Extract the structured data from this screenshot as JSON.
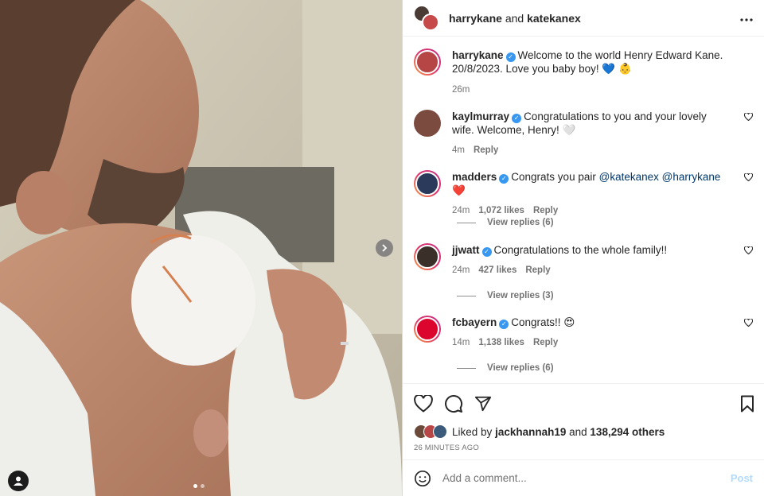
{
  "media": {
    "slides": 2,
    "active_slide": 1,
    "next_icon": "chevron-right-icon",
    "tag_icon": "user-tag-icon"
  },
  "header": {
    "user1": "harrykane",
    "joiner": "and",
    "user2": "katekanex",
    "more_icon": "more-horizontal-icon"
  },
  "caption": {
    "username": "harrykane",
    "text": "Welcome to the world Henry Edward Kane. 20/8/2023. Love you baby boy! 💙 👶",
    "time": "26m"
  },
  "comments": [
    {
      "username": "kaylmurray",
      "text": "Congratulations to you and your lovely wife. Welcome, Henry! 🤍",
      "time": "4m",
      "likes": "",
      "reply": "Reply",
      "view_replies": ""
    },
    {
      "username": "madders",
      "text": "Congrats you pair",
      "mentions": [
        "@katekanex",
        "@harrykane"
      ],
      "emoji": "❤️",
      "time": "24m",
      "likes": "1,072 likes",
      "reply": "Reply",
      "view_replies": "View replies (6)"
    },
    {
      "username": "jjwatt",
      "text": "Congratulations to the whole family!!",
      "time": "24m",
      "likes": "427 likes",
      "reply": "Reply",
      "view_replies": "View replies (3)"
    },
    {
      "username": "fcbayern",
      "text": "Congrats!! 😍",
      "time": "14m",
      "likes": "1,138 likes",
      "reply": "Reply",
      "view_replies": "View replies (6)"
    }
  ],
  "actions": {
    "like_icon": "heart-icon",
    "comment_icon": "comment-icon",
    "share_icon": "send-icon",
    "save_icon": "bookmark-icon"
  },
  "likes_summary": {
    "prefix": "Liked by",
    "user": "jackhannah19",
    "joiner": "and",
    "others": "138,294 others"
  },
  "timestamp": "26 MINUTES AGO",
  "add_comment": {
    "placeholder": "Add a comment...",
    "post_label": "Post",
    "emoji_icon": "smiley-icon"
  },
  "colors": {
    "verified": "#3897f0",
    "mention": "#00376b",
    "post_disabled": "#b3dbff",
    "heart_emoji": "#e0245e"
  }
}
